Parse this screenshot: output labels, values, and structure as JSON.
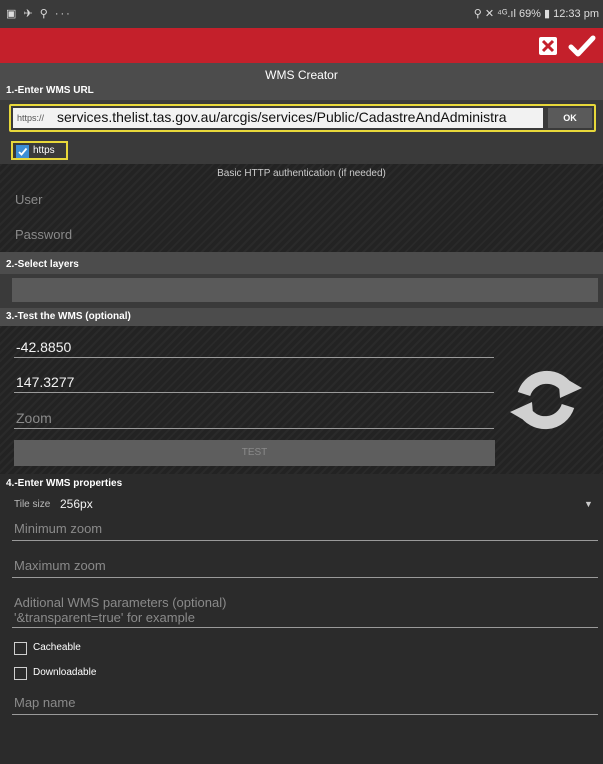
{
  "status_bar": {
    "left_icons": "▣ ✈ ⚲ ···",
    "right": "⚲ ✕ ⁴ᴳ.ıl 69% ▮ 12:33 pm"
  },
  "title": "WMS Creator",
  "section1": {
    "label": "1.-Enter WMS URL",
    "url_prefix": "https://",
    "url_value": "services.thelist.tas.gov.au/arcgis/services/Public/CadastreAndAdministra",
    "ok_label": "OK",
    "https_label": "https",
    "auth_title": "Basic HTTP authentication (if needed)",
    "user_placeholder": "User",
    "password_placeholder": "Password"
  },
  "section2": {
    "label": "2.-Select layers"
  },
  "section3": {
    "label": "3.-Test the WMS (optional)",
    "lat": "-42.8850",
    "lon": "147.3277",
    "zoom_placeholder": "Zoom",
    "test_label": "TEST"
  },
  "section4": {
    "label": "4.-Enter WMS properties",
    "tile_size_label": "Tile size",
    "tile_size_value": "256px",
    "min_zoom_placeholder": "Minimum zoom",
    "max_zoom_placeholder": "Maximum zoom",
    "aditional_line1": "Aditional WMS parameters (optional)",
    "aditional_line2": "'&transparent=true' for example",
    "cacheable_label": "Cacheable",
    "downloadable_label": "Downloadable",
    "map_name_placeholder": "Map name"
  },
  "colors": {
    "appbar": "#c4202b",
    "highlight": "#e8d83a",
    "check": "#3d8fd6"
  }
}
